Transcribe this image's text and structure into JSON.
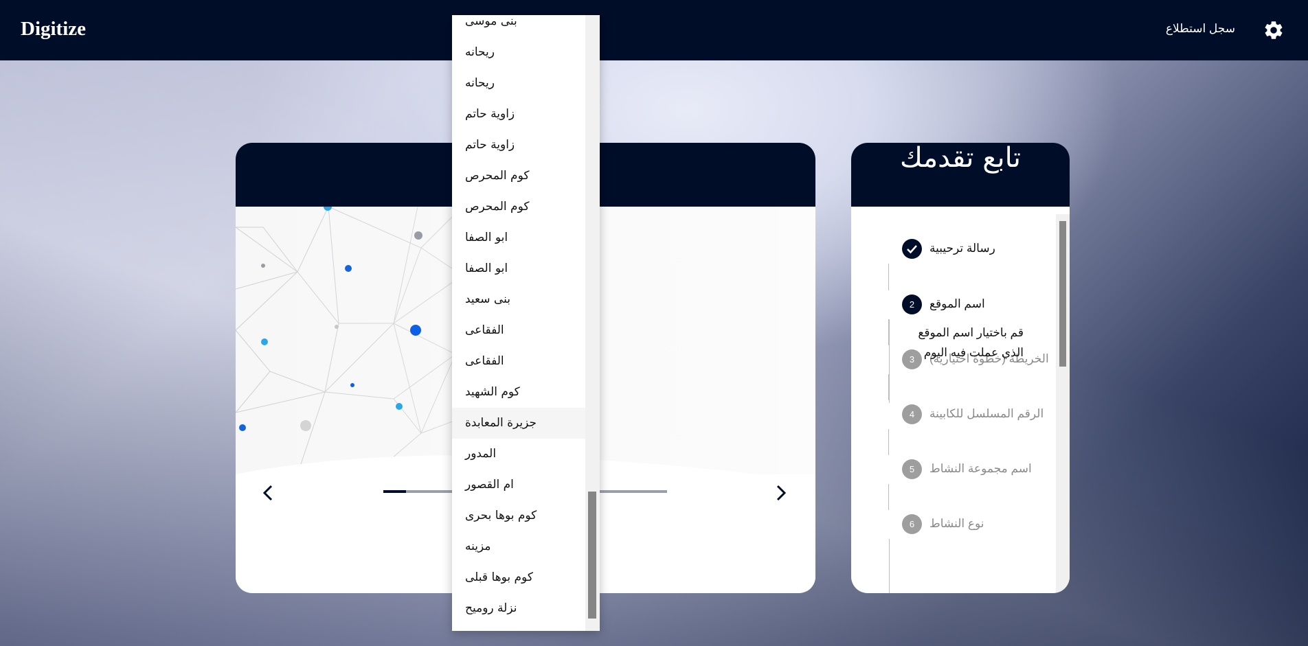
{
  "app": {
    "brand": "Digitize",
    "survey_log": "سجل استطلاع"
  },
  "icons": {
    "settings": "gear-icon",
    "prev": "chevron-left-icon",
    "next": "chevron-right-icon",
    "check": "check-icon"
  },
  "colors": {
    "navy": "#000d29",
    "completed": "#000d29",
    "pending": "#9e9e9e"
  },
  "slider": {
    "progress_fraction": 0.08
  },
  "progress_panel": {
    "title": "تابع تقدمك",
    "steps": [
      {
        "number": "",
        "label": "رسالة ترحيبية",
        "state": "done"
      },
      {
        "number": "2",
        "label": "اسم الموقع",
        "state": "active",
        "description": "قم باختيار اسم الموقع الذي عملت فيه اليوم"
      },
      {
        "number": "3",
        "label": "الخريطة (خطوة اختيارية)",
        "state": "pending"
      },
      {
        "number": "4",
        "label": "الرقم المسلسل للكابينة",
        "state": "pending"
      },
      {
        "number": "5",
        "label": "اسم مجموعة النشاط",
        "state": "pending"
      },
      {
        "number": "6",
        "label": "نوع النشاط",
        "state": "pending"
      }
    ]
  },
  "dropdown": {
    "items": [
      "بنى موسى",
      "ريحانه",
      "ريحانه",
      "زاوية حاتم",
      "زاوية حاتم",
      "كوم المحرص",
      "كوم المحرص",
      "ابو الصفا",
      "ابو الصفا",
      "بنى سعيد",
      "الفقاعى",
      "الفقاعى",
      "كوم الشهيد",
      "جزيرة المعابدة",
      "المدور",
      "ام القصور",
      "كوم بوها بحرى",
      "مزينه",
      "كوم بوها قبلى",
      "نزلة روميح"
    ],
    "hovered_index": 13
  }
}
